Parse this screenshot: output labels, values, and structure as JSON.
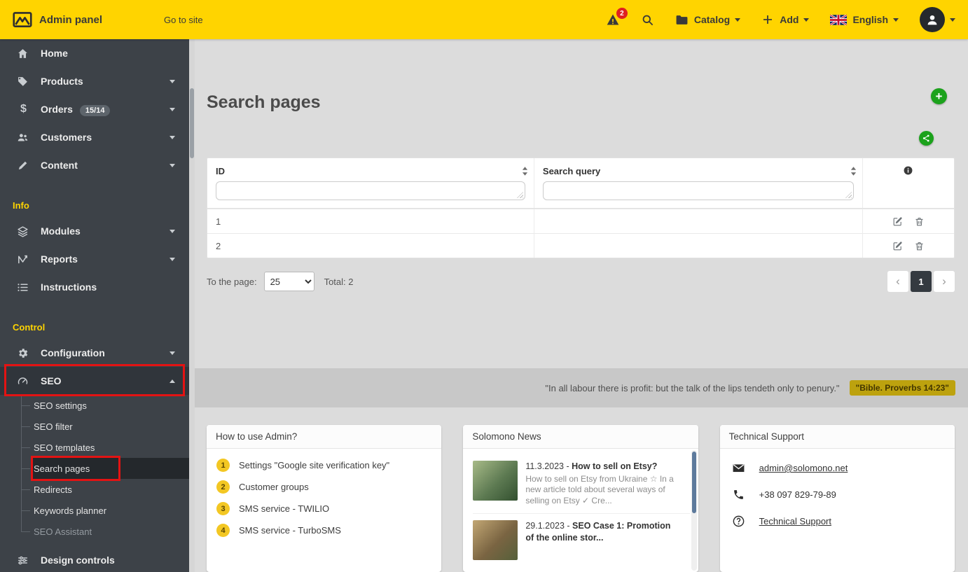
{
  "topbar": {
    "brand": "Admin panel",
    "go_to_site": "Go to site",
    "alerts_badge": "2",
    "catalog": "Catalog",
    "add": "Add",
    "language": "English"
  },
  "sidebar": {
    "items": [
      {
        "label": "Home"
      },
      {
        "label": "Products"
      },
      {
        "label": "Orders",
        "badge": "15/14"
      },
      {
        "label": "Customers"
      },
      {
        "label": "Content"
      }
    ],
    "section_info": "Info",
    "info_items": [
      {
        "label": "Modules"
      },
      {
        "label": "Reports"
      },
      {
        "label": "Instructions"
      }
    ],
    "section_control": "Control",
    "control_items": [
      {
        "label": "Configuration"
      },
      {
        "label": "SEO"
      }
    ],
    "seo_submenu": [
      {
        "label": "SEO settings"
      },
      {
        "label": "SEO filter"
      },
      {
        "label": "SEO templates"
      },
      {
        "label": "Search pages"
      },
      {
        "label": "Redirects"
      },
      {
        "label": "Keywords planner"
      },
      {
        "label": "SEO Assistant"
      }
    ],
    "bottom_item": "Design controls"
  },
  "main": {
    "title": "Search pages",
    "table": {
      "col_id": "ID",
      "col_query": "Search query",
      "rows": [
        {
          "id": "1"
        },
        {
          "id": "2"
        }
      ]
    },
    "footer": {
      "to_page_label": "To the page:",
      "page_size": "25",
      "total": "Total: 2",
      "prev": "‹",
      "page": "1",
      "next": "›"
    }
  },
  "quote": {
    "text": "\"In all labour there is profit: but the talk of the lips tendeth only to penury.\"",
    "badge": "\"Bible. Proverbs 14:23\""
  },
  "cards": {
    "howto": {
      "title": "How to use Admin?",
      "items": [
        {
          "num": "1",
          "text": "Settings \"Google site verification key\""
        },
        {
          "num": "2",
          "text": "Customer groups"
        },
        {
          "num": "3",
          "text": "SMS service - TWILIO"
        },
        {
          "num": "4",
          "text": "SMS service - TurboSMS"
        }
      ]
    },
    "news": {
      "title": "Solomono News",
      "items": [
        {
          "date": "11.3.2023 - ",
          "title": "How to sell on Etsy?",
          "desc": "How to sell on Etsy from Ukraine ☆ In a new article told about several ways of selling on Etsy ✓ Cre..."
        },
        {
          "date": "29.1.2023 - ",
          "title": "SEO Case 1: Promotion of the online stor...",
          "desc": ""
        }
      ]
    },
    "support": {
      "title": "Technical Support",
      "items": [
        {
          "icon": "envelope-icon",
          "text": "admin@solomono.net"
        },
        {
          "icon": "phone-icon",
          "text": "+38 097 829-79-89"
        },
        {
          "icon": "question-circle-icon",
          "text": "Technical Support"
        }
      ]
    }
  },
  "colors": {
    "accent_yellow": "#ffd400",
    "sidebar_dark": "#3d4248",
    "green_action": "#1ca21c",
    "annotation_red": "#e31313",
    "pager_active": "#343a40"
  },
  "icons": {
    "edit": "pencil-square",
    "delete": "trash",
    "sort": "up-down-arrows",
    "info": "info-circle"
  }
}
